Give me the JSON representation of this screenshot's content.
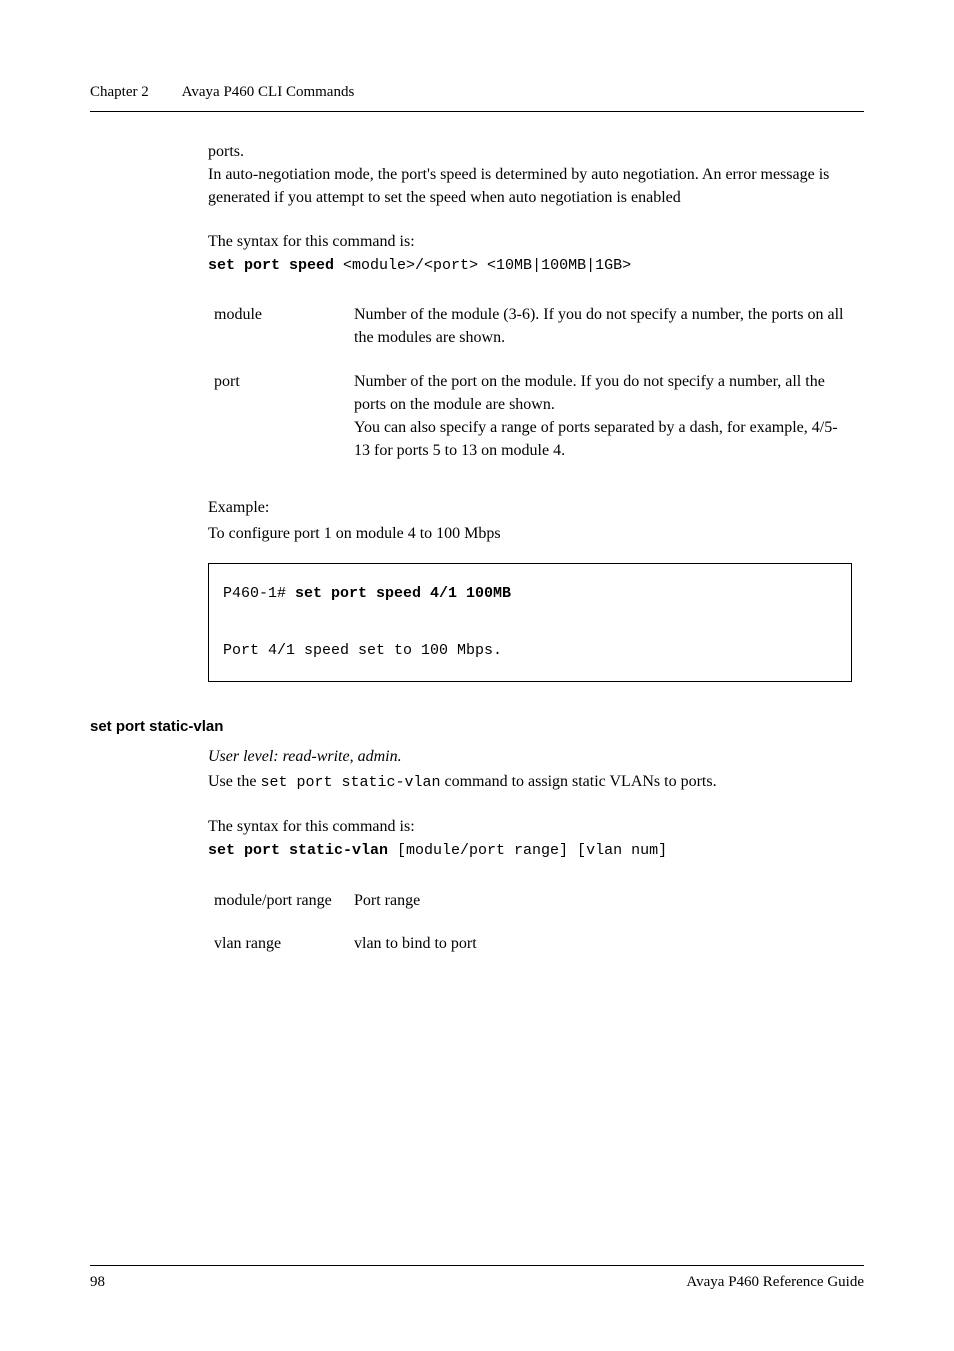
{
  "header": {
    "chapter": "Chapter 2",
    "title": "Avaya P460 CLI Commands"
  },
  "body": {
    "para1_a": "ports.",
    "para1_b": "In auto-negotiation mode, the port's speed is determined by auto negotiation. An error message is generated if you attempt to set the speed when auto negotiation is enabled",
    "syntax_intro": "The syntax for this command is:",
    "syntax_cmd_bold": "set port speed",
    "syntax_cmd_rest": " <module>/<port> <10MB|100MB|1GB>",
    "params": [
      {
        "name": "module",
        "desc": "Number of the module (3-6). If you do not specify a number, the ports on all the modules are shown."
      },
      {
        "name": "port",
        "desc": "Number of the port on the module. If you do not specify a number, all the ports on the module are shown.\nYou can also specify a range of ports separated by a dash, for example, 4/5-13 for ports 5 to 13 on module 4."
      }
    ],
    "example_label": "Example:",
    "example_desc": "To configure port 1 on module 4 to 100 Mbps",
    "code_prompt": "P460-1# ",
    "code_cmd": "set port speed 4/1 100MB",
    "code_output": "Port 4/1 speed set to 100 Mbps."
  },
  "section2": {
    "heading": "set port static-vlan",
    "user_level": "User level: read-write, admin.",
    "desc_a": "Use the ",
    "desc_code": "set port static-vlan",
    "desc_b": " command to assign static VLANs to ports.",
    "syntax_intro": "The syntax for this command is:",
    "syntax_cmd_bold": "set port static-vlan",
    "syntax_cmd_rest": " [module/port range] [vlan num]",
    "params": [
      {
        "name": "module/port range",
        "desc": "Port range"
      },
      {
        "name": "vlan range",
        "desc": "vlan to bind to port"
      }
    ]
  },
  "footer": {
    "page": "98",
    "doc": "Avaya P460 Reference Guide"
  }
}
